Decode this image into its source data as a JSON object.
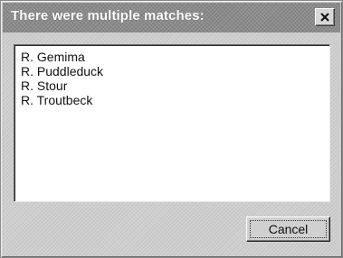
{
  "dialog": {
    "title": "There were multiple matches:",
    "close_icon": "close-icon"
  },
  "matches": {
    "items": [
      "R. Gemima",
      "R. Puddleduck",
      "R. Stour",
      "R. Troutbeck"
    ]
  },
  "buttons": {
    "cancel_label": "Cancel"
  }
}
